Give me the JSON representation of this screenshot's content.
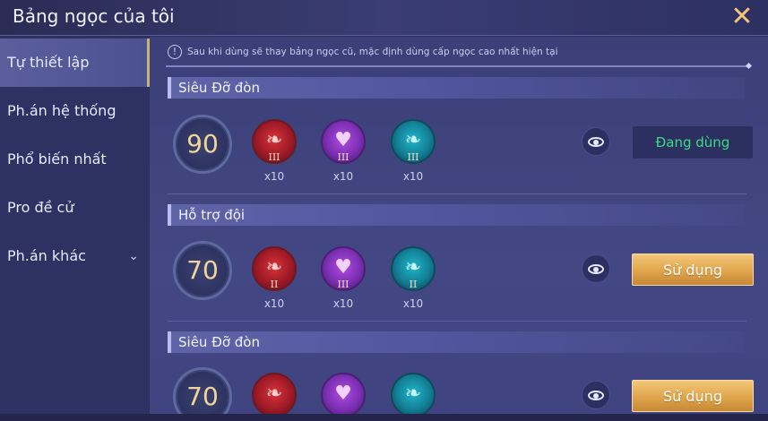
{
  "header": {
    "title": "Bảng ngọc của tôi",
    "close_icon": "✕"
  },
  "sidebar": {
    "items": [
      {
        "label": "Tự thiết lập",
        "active": true
      },
      {
        "label": "Ph.án hệ thống",
        "active": false
      },
      {
        "label": "Phổ biến nhất",
        "active": false
      },
      {
        "label": "Pro đề cử",
        "active": false
      },
      {
        "label": "Ph.án khác",
        "active": false,
        "chevron": "⌄"
      }
    ]
  },
  "notice": {
    "icon": "!",
    "text": "Sau khi dùng sẽ thay bảng ngọc cũ, mặc định dùng cấp ngọc cao nhất hiện tại"
  },
  "sets": [
    {
      "name": "Siêu Đỡ đòn",
      "level": "90",
      "gems": [
        {
          "color": "red",
          "tier": "III",
          "count": "x10"
        },
        {
          "color": "purple",
          "tier": "III",
          "count": "x10"
        },
        {
          "color": "teal",
          "tier": "III",
          "count": "x10"
        }
      ],
      "action_label": "Đang dùng"
    },
    {
      "name": "Hỗ trợ đội",
      "level": "70",
      "gems": [
        {
          "color": "red",
          "tier": "II",
          "count": "x10"
        },
        {
          "color": "purple",
          "tier": "III",
          "count": "x10"
        },
        {
          "color": "teal",
          "tier": "II",
          "count": "x10"
        }
      ],
      "action_label": "Sử dụng"
    },
    {
      "name": "Siêu Đỡ đòn",
      "level": "70",
      "gems": [
        {
          "color": "red"
        },
        {
          "color": "purple"
        },
        {
          "color": "teal"
        }
      ],
      "action_label": "Sử dụng"
    }
  ],
  "colors": {
    "accent_gold": "#f0c777",
    "in_use_green": "#3bdb86",
    "use_button": "#e0a54c"
  }
}
